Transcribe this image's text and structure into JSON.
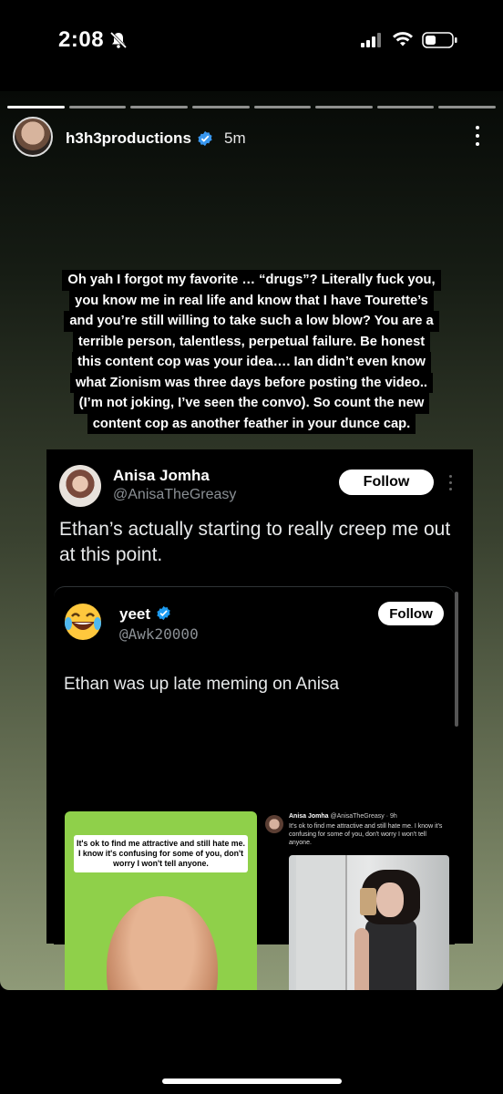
{
  "status": {
    "time": "2:08",
    "icons": [
      "bell-slash-icon",
      "cellular-signal-icon",
      "wifi-icon",
      "battery-icon"
    ]
  },
  "story": {
    "progress_segments": 8,
    "active_segment": 1,
    "account": {
      "username": "h3h3productions",
      "verified": true,
      "time_ago": "5m"
    },
    "caption_lines": [
      "Oh yah I forgot my favorite … “drugs”? Literally fuck you,",
      "you know me in real life and know that I have Tourette’s",
      "and you’re still willing to take such a low blow? You are a",
      "terrible person, talentless, perpetual failure. Be honest",
      "this content cop was your idea…. Ian didn’t even know",
      "what Zionism was three days before posting the video..",
      "(I’m not joking, I’ve seen the convo). So count the new",
      "content cop as another feather in your dunce cap."
    ],
    "embedded_post": {
      "author_name": "Anisa Jomha",
      "author_handle": "@AnisaTheGreasy",
      "follow_label": "Follow",
      "text": "Ethan’s actually starting to really creep me out at this point.",
      "quoted": {
        "name": "yeet",
        "verified": true,
        "handle": "@Awk20000",
        "follow_label": "Follow",
        "text": "Ethan was up late meming on Anisa",
        "meme_caption": "It's ok to find me attractive and still hate me. I know it's confusing for some of you, don't worry I won't tell anyone.",
        "right_header_name": "Anisa Jomha",
        "right_header_meta": "@AnisaTheGreasy · 9h",
        "right_text": "It's ok to find me attractive and still hate me. I know it's confusing for some of you, don't worry I won't tell anyone."
      }
    }
  },
  "colors": {
    "verified_blue": "#1d9bf0",
    "instagram_verified": "#3897f0",
    "caption_bg": "#000000",
    "meme_green": "#8fd04a"
  }
}
